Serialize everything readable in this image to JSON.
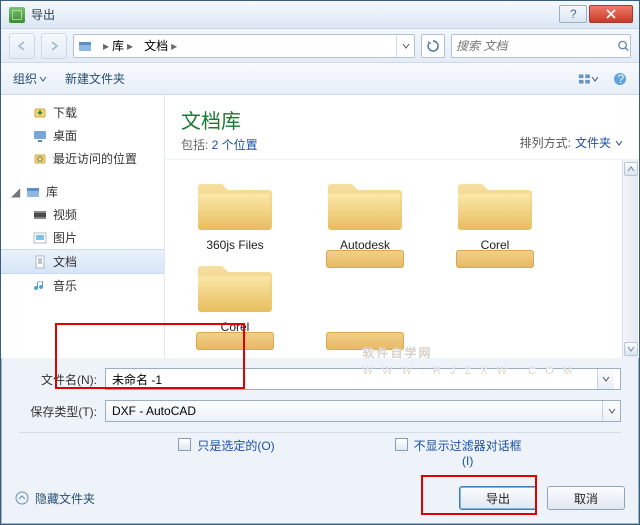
{
  "window": {
    "title": "导出"
  },
  "nav": {
    "crumbs": [
      "库",
      "文档"
    ],
    "search_placeholder": "搜索 文档"
  },
  "toolbar": {
    "organize": "组织",
    "new_folder": "新建文件夹"
  },
  "sidebar": {
    "favorites": {
      "items": [
        {
          "icon": "download",
          "label": "下载"
        },
        {
          "icon": "desktop",
          "label": "桌面"
        },
        {
          "icon": "recent",
          "label": "最近访问的位置"
        }
      ]
    },
    "libraries": {
      "head": "库",
      "items": [
        {
          "icon": "video",
          "label": "视频"
        },
        {
          "icon": "pictures",
          "label": "图片"
        },
        {
          "icon": "document",
          "label": "文档",
          "selected": true
        },
        {
          "icon": "music",
          "label": "音乐"
        }
      ]
    }
  },
  "content": {
    "library_title": "文档库",
    "library_sub_prefix": "包括: ",
    "library_sub_link": "2 个位置",
    "sort_label": "排列方式:",
    "sort_value": "文件夹",
    "folders": [
      "360js Files",
      "Autodesk",
      "Corel",
      "Corel"
    ]
  },
  "form": {
    "filename_label": "文件名(N):",
    "filename_value": "未命名 -1",
    "filetype_label": "保存类型(T):",
    "filetype_value": "DXF - AutoCAD"
  },
  "options": {
    "selected_only": "只是选定的(O)",
    "no_filter_dialog_line1": "不显示过滤器对话框",
    "no_filter_dialog_line2": "(I)"
  },
  "footer": {
    "hide_folders": "隐藏文件夹",
    "export": "导出",
    "cancel": "取消"
  },
  "watermark": {
    "big": "软件自学网",
    "small": "W W W . R J Z X W . C O M"
  }
}
